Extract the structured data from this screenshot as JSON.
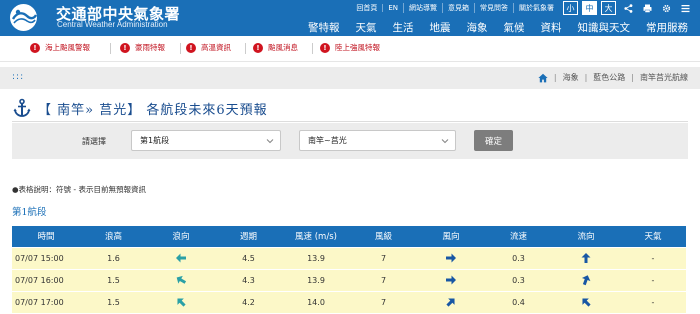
{
  "brand": {
    "name_zh": "交通部中央氣象署",
    "name_en": "Central Weather Administration"
  },
  "top_links": [
    "回首頁",
    "EN",
    "網站導覽",
    "意見箱",
    "常見問答",
    "關於氣象署"
  ],
  "font_sizes": [
    "小",
    "中",
    "大"
  ],
  "main_nav": [
    "警特報",
    "天氣",
    "生活",
    "地震",
    "海象",
    "氣候",
    "資料",
    "知識與天文",
    "常用服務"
  ],
  "alerts": [
    "海上颱風警報",
    "豪雨特報",
    "高溫資訊",
    "颱風消息",
    "陸上強風特報"
  ],
  "breadcrumb": [
    "海象",
    "藍色公路",
    "南竿莒光航線"
  ],
  "title": "【 南竿» 莒光】 各航段未來6天預報",
  "selector": {
    "label": "請選擇",
    "segment_value": "第1航段",
    "route_value": "南竿~莒光",
    "confirm_label": "確定"
  },
  "note": "●表格說明：符號 - 表示目前無預報資訊",
  "section_title": "第1航段",
  "table": {
    "headers": [
      "時間",
      "浪高",
      "浪向",
      "週期",
      "風速 (m/s)",
      "風級",
      "風向",
      "流速",
      "流向",
      "天氣"
    ],
    "rows": [
      {
        "time": "07/07 15:00",
        "wave_height": "1.6",
        "wave_dir_deg": 270,
        "period": "4.5",
        "wind_speed": "13.9",
        "wind_level": "7",
        "wind_dir_deg": 90,
        "current_speed": "0.3",
        "current_dir_deg": 0,
        "weather": "-"
      },
      {
        "time": "07/07 16:00",
        "wave_height": "1.5",
        "wave_dir_deg": 300,
        "period": "4.3",
        "wind_speed": "13.9",
        "wind_level": "7",
        "wind_dir_deg": 90,
        "current_speed": "0.3",
        "current_dir_deg": 20,
        "weather": "-"
      },
      {
        "time": "07/07 17:00",
        "wave_height": "1.5",
        "wave_dir_deg": 315,
        "period": "4.2",
        "wind_speed": "14.0",
        "wind_level": "7",
        "wind_dir_deg": 45,
        "current_speed": "0.4",
        "current_dir_deg": 315,
        "weather": "-"
      }
    ]
  },
  "colors": {
    "brand_blue": "#1a6fb7",
    "alert_red": "#d0141f",
    "row_yellow": "#fcf8c8",
    "wave_arrow": "#2aa0a6",
    "wind_arrow": "#1857a4"
  }
}
